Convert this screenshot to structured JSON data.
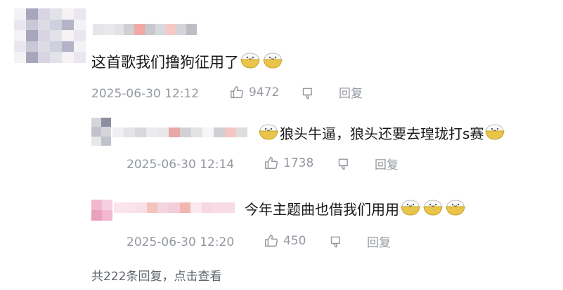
{
  "colors": {
    "text": "#18191c",
    "meta": "#9499a0",
    "link": "#61666d",
    "emote_bowl": "#e9c54b"
  },
  "icons": [
    "thumbs-up-icon",
    "thumbs-down-icon",
    "bowl-face-emote"
  ],
  "comment": {
    "text": "这首歌我们撸狗征用了",
    "date": "2025-06-30 12:12",
    "likes": "9472",
    "reply_label": "回复"
  },
  "replies": [
    {
      "text_a": "狼头牛逼，狼头还要去瑝珑打s赛",
      "date": "2025-06-30 12:14",
      "likes": "1738",
      "reply_label": "回复"
    },
    {
      "text_a": "今年主题曲也借我们用用",
      "date": "2025-06-30 12:20",
      "likes": "450",
      "reply_label": "回复"
    }
  ],
  "total_replies": "共222条回复，点击查看"
}
